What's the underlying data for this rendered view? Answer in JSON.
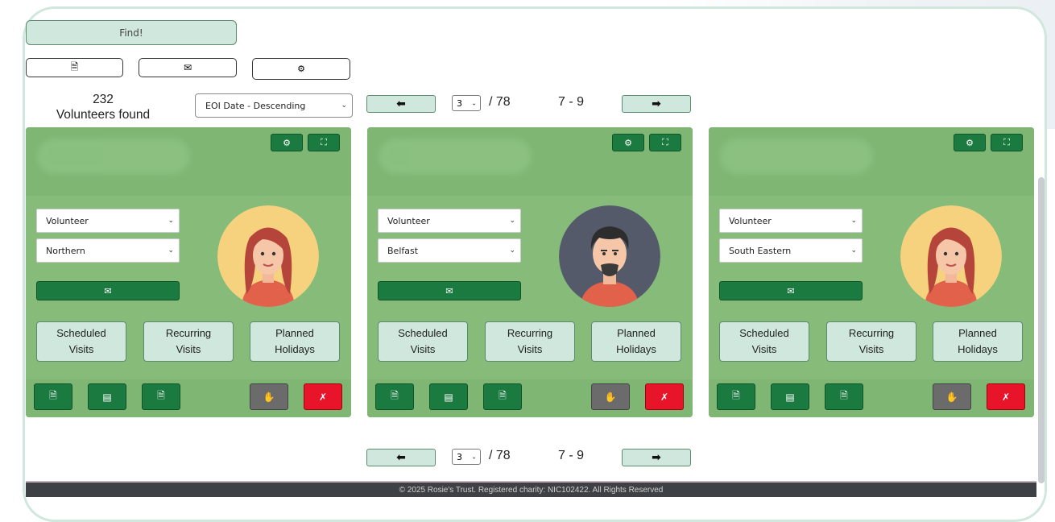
{
  "toolbar": {
    "find_label": "Find!",
    "buttons": [
      {
        "icon": "document-icon",
        "glyph": "🗎"
      },
      {
        "icon": "envelope-icon",
        "glyph": "✉"
      },
      {
        "icon": "gears-icon",
        "glyph": "⚙"
      }
    ]
  },
  "results": {
    "count": "232",
    "count_label": "Volunteers found",
    "sort_value": "EOI Date - Descending"
  },
  "pager": {
    "prev_glyph": "⬅",
    "next_glyph": "➡",
    "page": "3",
    "total": "/ 78",
    "range": "7 - 9"
  },
  "cards": [
    {
      "role": "Volunteer",
      "region": "Northern",
      "avatar": "woman-red-hair",
      "visits": [
        {
          "line1": "Scheduled",
          "line2": "Visits"
        },
        {
          "line1": "Recurring",
          "line2": "Visits"
        },
        {
          "line1": "Planned",
          "line2": "Holidays"
        }
      ]
    },
    {
      "role": "Volunteer",
      "region": "Belfast",
      "avatar": "man-beard",
      "visits": [
        {
          "line1": "Scheduled",
          "line2": "Visits"
        },
        {
          "line1": "Recurring",
          "line2": "Visits"
        },
        {
          "line1": "Planned",
          "line2": "Holidays"
        }
      ]
    },
    {
      "role": "Volunteer",
      "region": "South Eastern",
      "avatar": "woman-red-hair",
      "visits": [
        {
          "line1": "Scheduled",
          "line2": "Visits"
        },
        {
          "line1": "Recurring",
          "line2": "Visits"
        },
        {
          "line1": "Planned",
          "line2": "Holidays"
        }
      ]
    }
  ],
  "card_icons": {
    "settings": "⚙",
    "expand": "⛶",
    "mail": "✉",
    "doc1": "🗎",
    "doc2": "▤",
    "doc3": "🗎",
    "hand": "✋",
    "close": "✗"
  },
  "colors": {
    "card_bg": "#86bb7a",
    "dark_green": "#1b7a40",
    "light_green": "#cfe7dc",
    "red": "#e8142a"
  },
  "footer": {
    "text": "© 2025 Rosie's Trust. Registered charity: NIC102422. All Rights Reserved"
  }
}
